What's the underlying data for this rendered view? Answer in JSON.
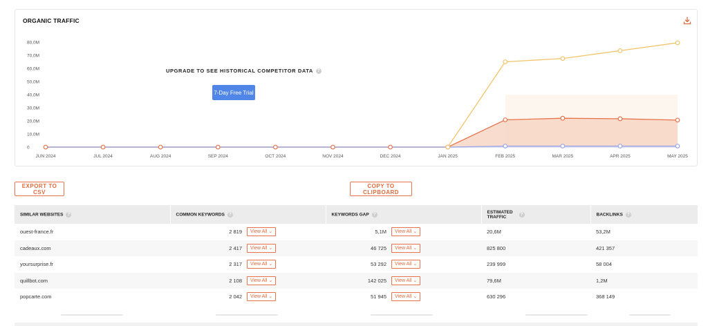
{
  "chart_title": "ORGANIC TRAFFIC",
  "icons": {
    "download": "download-icon",
    "info": "info-icon",
    "chevron": "chevron-down-icon"
  },
  "upgrade": {
    "text": "UPGRADE TO SEE HISTORICAL COMPETITOR DATA",
    "trial_button": "7-Day Free Trial"
  },
  "chart_data": {
    "type": "line",
    "categories": [
      "JUN 2024",
      "JUL 2024",
      "AUG 2024",
      "SEP 2024",
      "OCT 2024",
      "NOV 2024",
      "DEC 2024",
      "JAN 2025",
      "FEB 2025",
      "MAR 2025",
      "APR 2025",
      "MAY 2025"
    ],
    "ytick_labels": [
      "0",
      "10,0M",
      "20,0M",
      "30,0M",
      "40,0M",
      "50,0M",
      "60,0M",
      "70,0M",
      "80,0M"
    ],
    "ylim": [
      0,
      80
    ],
    "grid": true,
    "series": [
      {
        "color": "#f2c46a",
        "values": [
          0,
          0,
          0,
          0,
          0,
          0,
          0,
          0,
          65,
          67.5,
          73.5,
          79.5
        ]
      },
      {
        "color": "#e8734a",
        "values": [
          0,
          0,
          0,
          0,
          0,
          0,
          0,
          0,
          20.8,
          22,
          21.6,
          20.6
        ]
      },
      {
        "color": "#9aa6e8",
        "values": [
          0,
          0,
          0,
          0,
          0,
          0,
          0,
          0,
          0.8,
          0.8,
          0.8,
          0.8
        ]
      }
    ]
  },
  "actions": {
    "export": "EXPORT TO CSV",
    "copy": "COPY TO CLIPBOARD"
  },
  "table": {
    "headers": [
      "SIMILAR WEBSITES",
      "COMMON KEYWORDS",
      "KEYWORDS GAP",
      "ESTIMATED TRAFFIC",
      "BACKLINKS"
    ],
    "view_all_label": "View All",
    "rows": [
      {
        "site": "ouest-france.fr",
        "common": "2 819",
        "gap": "5,1M",
        "traffic": "20,6M",
        "backlinks": "53,2M"
      },
      {
        "site": "cadeaux.com",
        "common": "2 417",
        "gap": "46 725",
        "traffic": "825 800",
        "backlinks": "421 357"
      },
      {
        "site": "yoursurprise.fr",
        "common": "2 317",
        "gap": "53 292",
        "traffic": "239 999",
        "backlinks": "58 004"
      },
      {
        "site": "quillbot.com",
        "common": "2 108",
        "gap": "142 025",
        "traffic": "79,6M",
        "backlinks": "1,2M"
      },
      {
        "site": "popcarte.com",
        "common": "2 042",
        "gap": "51 945",
        "traffic": "630 296",
        "backlinks": "368 149"
      }
    ]
  }
}
